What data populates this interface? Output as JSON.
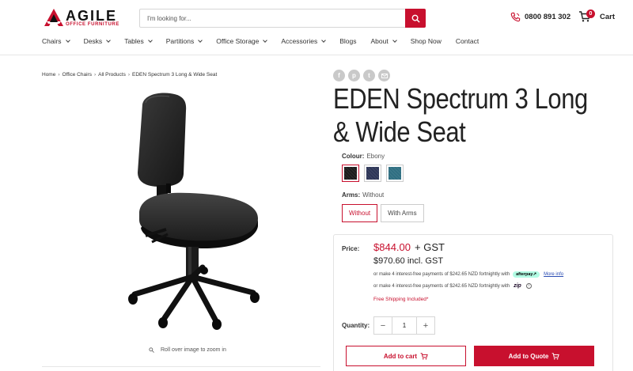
{
  "brand": {
    "name": "AGILE",
    "tagline": "OFFICE FURNITURE",
    "accent": "#c8102e"
  },
  "search": {
    "placeholder": "I'm looking for..."
  },
  "contact": {
    "phone": "0800 891 302"
  },
  "cart": {
    "label": "Cart",
    "count": "0"
  },
  "nav": [
    {
      "label": "Chairs",
      "dropdown": true
    },
    {
      "label": "Desks",
      "dropdown": true
    },
    {
      "label": "Tables",
      "dropdown": true
    },
    {
      "label": "Partitions",
      "dropdown": true
    },
    {
      "label": "Office Storage",
      "dropdown": true
    },
    {
      "label": "Accessories",
      "dropdown": true
    },
    {
      "label": "Blogs",
      "dropdown": false
    },
    {
      "label": "About",
      "dropdown": true
    },
    {
      "label": "Shop Now",
      "dropdown": false
    },
    {
      "label": "Contact",
      "dropdown": false
    }
  ],
  "breadcrumb": [
    "Home",
    "Office Chairs",
    "All Products",
    "EDEN Spectrum 3 Long & Wide Seat"
  ],
  "product": {
    "title": "EDEN Spectrum 3 Long & Wide Seat",
    "zoom_hint": "Roll over image to zoom in",
    "colour_label": "Colour:",
    "colour_value": "Ebony",
    "swatches": [
      "#1c1c1c",
      "#2e3658",
      "#2f6f82"
    ],
    "arms_label": "Arms:",
    "arms_value": "Without",
    "arms_options": [
      "Without",
      "With Arms"
    ]
  },
  "pricing": {
    "label": "Price:",
    "price": "$844.00",
    "gst": "+ GST",
    "incl": "$970.60 incl. GST",
    "afterpay_text": "or make 4 interest-free payments of $242.65 NZD fortnightly with",
    "afterpay_badge": "afterpay↗",
    "more_info": "More info",
    "zip_text": "or make 4 interest-free payments of $242.65 NZD fortnightly with",
    "zip_badge": "zip",
    "free_shipping": "Free Shipping Included*"
  },
  "quantity": {
    "label": "Quantity:",
    "value": "1"
  },
  "actions": {
    "add_to_cart": "Add to cart",
    "add_to_quote": "Add to Quote"
  }
}
